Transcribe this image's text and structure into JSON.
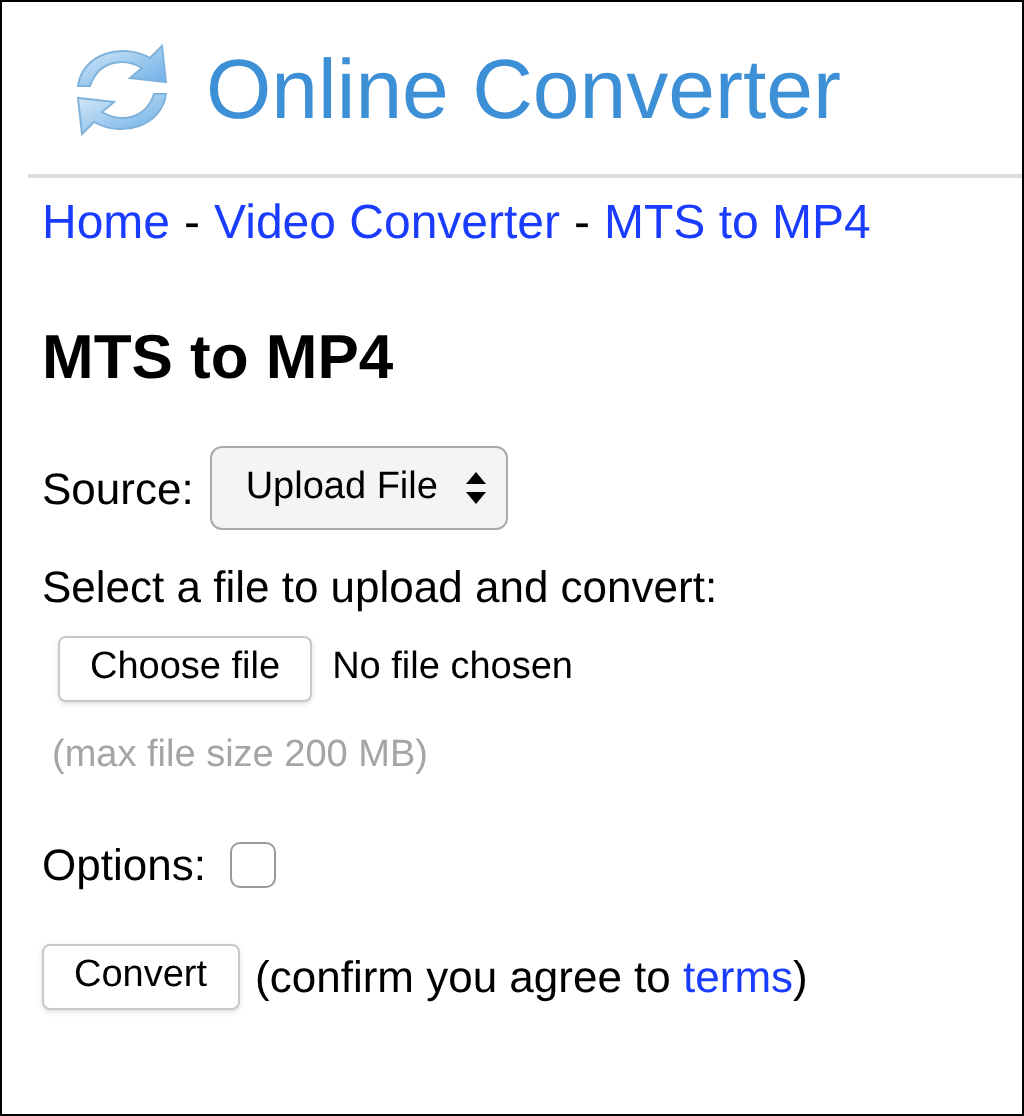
{
  "header": {
    "title": "Online Converter"
  },
  "breadcrumb": [
    {
      "kind": "link",
      "text": "Home"
    },
    {
      "kind": "separator",
      "text": "-"
    },
    {
      "kind": "link",
      "text": "Video Converter"
    },
    {
      "kind": "separator",
      "text": "-"
    },
    {
      "kind": "link",
      "text": "MTS to MP4"
    }
  ],
  "heading": "MTS to MP4",
  "source": {
    "label": "Source:",
    "value": "Upload File"
  },
  "upload": {
    "prompt": "Select a file to upload and convert:",
    "button": "Choose file",
    "status": "No file chosen",
    "hint": "(max file size 200 MB)"
  },
  "options": {
    "label": "Options:",
    "checked": false
  },
  "convert": {
    "button": "Convert",
    "note_before": "(confirm you agree to ",
    "link": "terms",
    "note_after": ")"
  }
}
